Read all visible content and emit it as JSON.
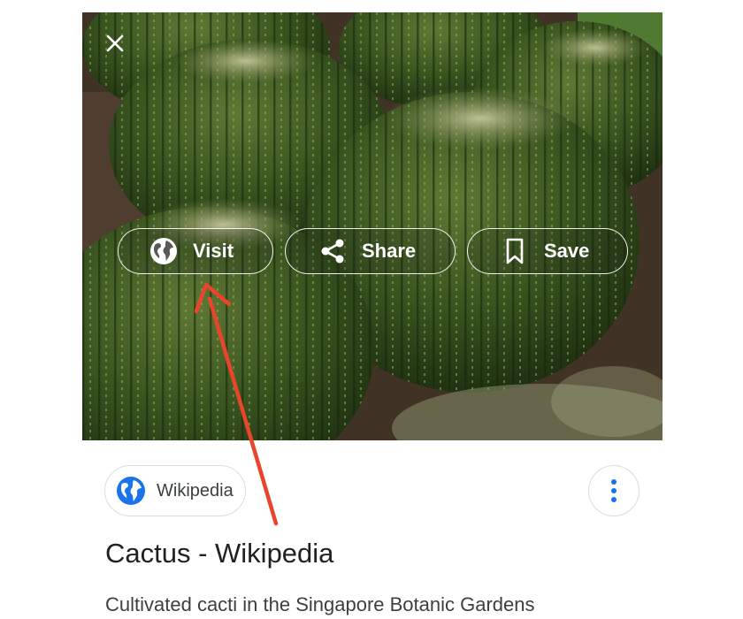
{
  "image_viewer": {
    "close_icon": "close-icon",
    "subject": "barrel cacti",
    "actions": [
      {
        "label": "Visit",
        "icon": "globe-icon"
      },
      {
        "label": "Share",
        "icon": "share-icon"
      },
      {
        "label": "Save",
        "icon": "bookmark-icon"
      }
    ]
  },
  "result": {
    "source_label": "Wikipedia",
    "source_icon": "globe-icon",
    "more_icon": "more-vertical-icon",
    "title": "Cactus - Wikipedia",
    "caption": "Cultivated cacti in the Singapore Botanic Gardens"
  },
  "colors": {
    "annotation_arrow": "#e8452c",
    "accent_blue": "#1a73e8",
    "title_text": "#202124",
    "chip_border": "#dadce0"
  }
}
